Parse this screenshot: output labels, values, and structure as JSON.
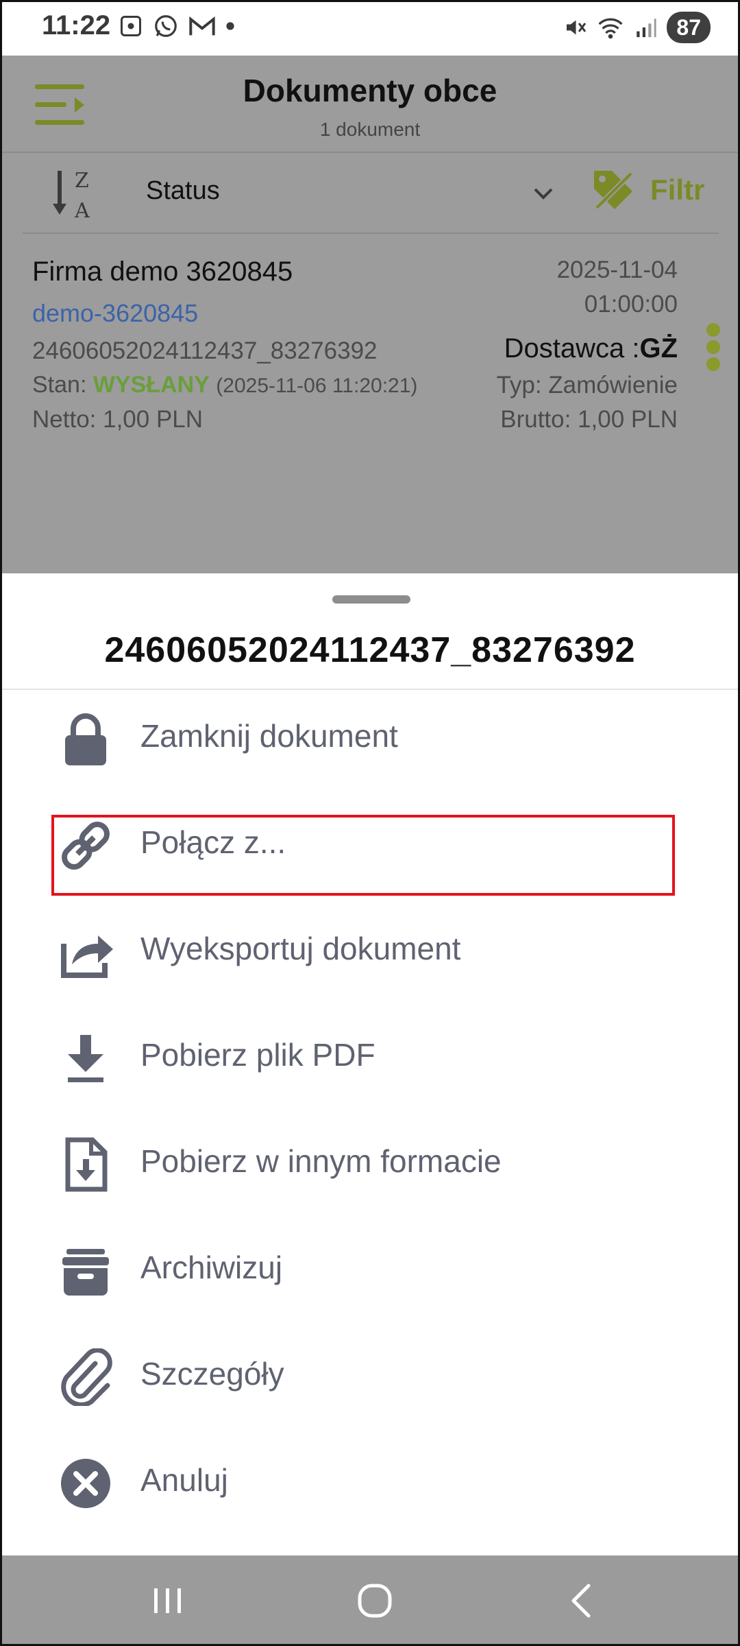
{
  "status_bar": {
    "time": "11:22",
    "battery": "87",
    "icons_left": [
      "screenshot-icon",
      "whatsapp-icon",
      "gmail-icon",
      "dot-icon"
    ],
    "icons_right": [
      "mute-icon",
      "wifi-icon",
      "signal-icon",
      "battery-icon"
    ]
  },
  "header": {
    "title": "Dokumenty obce",
    "subtitle": "1 dokument"
  },
  "toolbar": {
    "sort_label": "Status",
    "filter_label": "Filtr"
  },
  "document": {
    "company": "Firma demo 3620845",
    "link": "demo-3620845",
    "number": "24606052024112437_83276392",
    "state_prefix": "Stan: ",
    "state_value": "WYSŁANY",
    "state_timestamp": "(2025-11-06 11:20:21)",
    "net": "Netto: 1,00 PLN",
    "date": "2025-11-04",
    "time": "01:00:00",
    "supplier_prefix": "Dostawca :",
    "supplier_code": "GŻ",
    "type": "Typ: Zamówienie",
    "gross": "Brutto: 1,00 PLN"
  },
  "sheet": {
    "title": "24606052024112437_83276392",
    "items": [
      {
        "label": "Zamknij dokument",
        "icon": "lock-icon"
      },
      {
        "label": "Połącz z...",
        "icon": "link-icon"
      },
      {
        "label": "Wyeksportuj dokument",
        "icon": "export-icon"
      },
      {
        "label": "Pobierz plik PDF",
        "icon": "download-icon"
      },
      {
        "label": "Pobierz w innym formacie",
        "icon": "file-download-icon"
      },
      {
        "label": "Archiwizuj",
        "icon": "archive-icon"
      },
      {
        "label": "Szczegóły",
        "icon": "paperclip-icon"
      },
      {
        "label": "Anuluj",
        "icon": "cancel-icon"
      }
    ]
  },
  "colors": {
    "accent": "#7c8a27",
    "status_green": "#6a9e3b",
    "link_blue": "#3c63a8",
    "highlight_red": "#e2141d",
    "icon_gray": "#5f6270"
  }
}
